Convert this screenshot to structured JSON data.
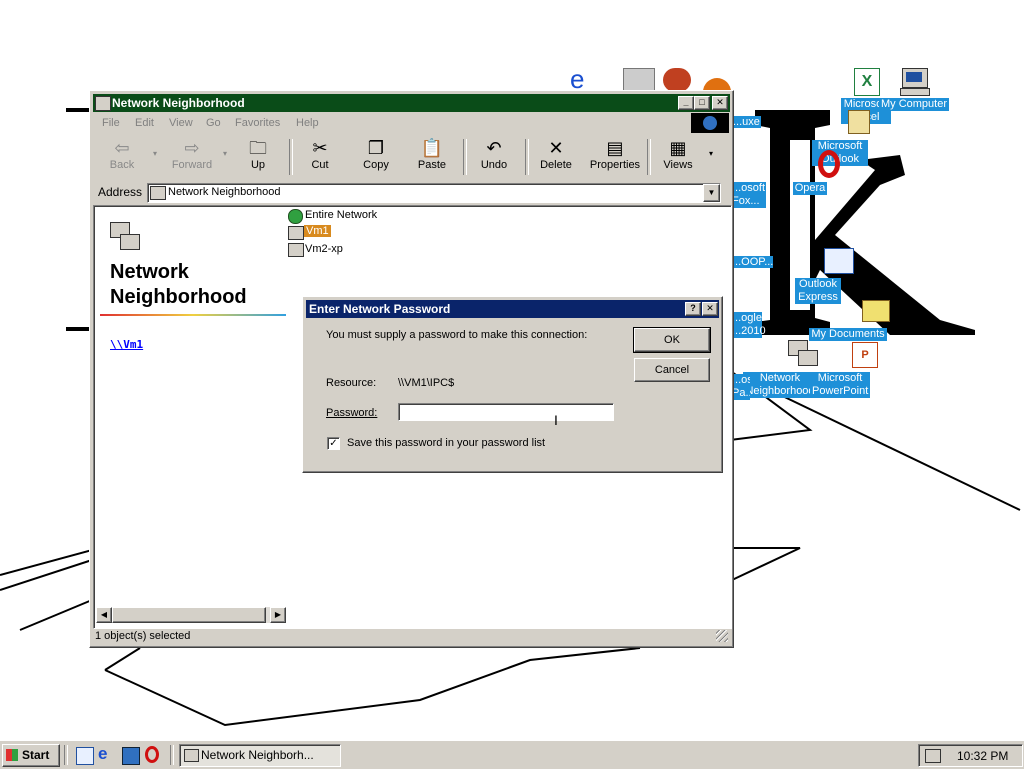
{
  "desktop": {
    "icons": [
      {
        "label": "My Computer"
      },
      {
        "label": "Microsoft Excel"
      },
      {
        "label": "Microsoft Outlook"
      },
      {
        "label": "Opera"
      },
      {
        "label": "Outlook Express"
      },
      {
        "label": "My Documents"
      },
      {
        "label": "Network Neighborhood"
      },
      {
        "label": "Microsoft PowerPoint"
      },
      {
        "label": "...uxe"
      },
      {
        "label": "...osoft Fox..."
      },
      {
        "label": "...OOP..."
      },
      {
        "label": "...ogle ...2010"
      },
      {
        "label": "...oso Pa..."
      }
    ]
  },
  "explorer": {
    "title": "Network Neighborhood",
    "menu": [
      "File",
      "Edit",
      "View",
      "Go",
      "Favorites",
      "Help"
    ],
    "toolbar": [
      {
        "label": "Back",
        "icon": "back-arrow-icon"
      },
      {
        "label": "Forward",
        "icon": "forward-arrow-icon"
      },
      {
        "label": "Up",
        "icon": "up-folder-icon"
      },
      {
        "label": "Cut",
        "icon": "scissors-icon"
      },
      {
        "label": "Copy",
        "icon": "copy-icon"
      },
      {
        "label": "Paste",
        "icon": "paste-icon"
      },
      {
        "label": "Undo",
        "icon": "undo-icon"
      },
      {
        "label": "Delete",
        "icon": "delete-x-icon"
      },
      {
        "label": "Properties",
        "icon": "properties-icon"
      },
      {
        "label": "Views",
        "icon": "views-icon"
      }
    ],
    "address_label": "Address",
    "address_value": "Network Neighborhood",
    "panel_title_line1": "Network",
    "panel_title_line2": "Neighborhood",
    "panel_link": "\\\\Vm1",
    "items": [
      {
        "label": "Entire Network"
      },
      {
        "label": "Vm1",
        "selected": true
      },
      {
        "label": "Vm2-xp"
      }
    ],
    "status": "1 object(s) selected"
  },
  "dialog": {
    "title": "Enter Network Password",
    "message": "You must supply a password to make this connection:",
    "resource_label": "Resource:",
    "resource_value": "\\\\VM1\\IPC$",
    "password_label": "Password:",
    "password_value": "",
    "save_label": "Save this password in your password list",
    "save_checked": true,
    "ok_label": "OK",
    "cancel_label": "Cancel"
  },
  "taskbar": {
    "start_label": "Start",
    "task_label": "Network Neighborh...",
    "clock": "10:32 PM"
  },
  "colors": {
    "explorer_title_bg": "#0a4c18",
    "dialog_title_bg": "#0a246a",
    "desktop_label_bg": "#1e90d8",
    "selection_bg": "#d88a1e"
  }
}
